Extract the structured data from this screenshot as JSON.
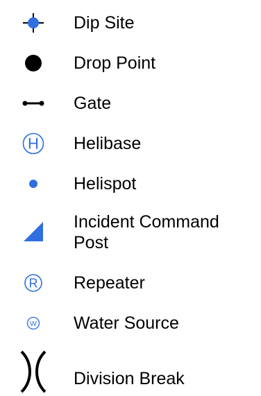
{
  "colors": {
    "blue": "#2F6FE0",
    "black": "#000000"
  },
  "legend": {
    "items": [
      {
        "icon": "dip-site-icon",
        "label": "Dip Site"
      },
      {
        "icon": "drop-point-icon",
        "label": "Drop Point"
      },
      {
        "icon": "gate-icon",
        "label": "Gate"
      },
      {
        "icon": "helibase-icon",
        "label": "Helibase",
        "icon_text": "H"
      },
      {
        "icon": "helispot-icon",
        "label": "Helispot"
      },
      {
        "icon": "incident-command-post-icon",
        "label_line1": "Incident Command",
        "label_line2": "Post"
      },
      {
        "icon": "repeater-icon",
        "label": "Repeater",
        "icon_text": "R"
      },
      {
        "icon": "water-source-icon",
        "label": "Water Source",
        "icon_text": "W"
      },
      {
        "icon": "division-break-icon",
        "label": "Division Break"
      }
    ]
  }
}
